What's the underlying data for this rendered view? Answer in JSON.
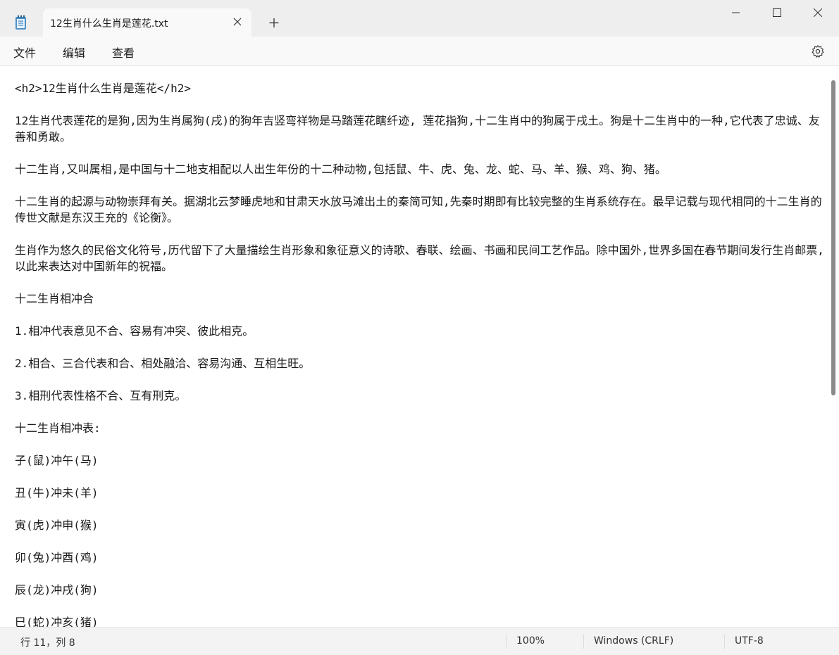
{
  "tab": {
    "title": "12生肖什么生肖是莲花.txt"
  },
  "menu": {
    "file": "文件",
    "edit": "编辑",
    "view": "查看"
  },
  "editor": {
    "lines": [
      "<h2>12生肖什么生肖是莲花</h2>",
      "12生肖代表莲花的是狗,因为生肖属狗(戌)的狗年吉竖弯祥物是马踏莲花瞎纤迹, 莲花指狗,十二生肖中的狗属于戌土。狗是十二生肖中的一种,它代表了忠诚、友善和勇敢。",
      "十二生肖,又叫属相,是中国与十二地支相配以人出生年份的十二种动物,包括鼠、牛、虎、兔、龙、蛇、马、羊、猴、鸡、狗、猪。",
      "十二生肖的起源与动物崇拜有关。据湖北云梦睡虎地和甘肃天水放马滩出土的秦简可知,先秦时期即有比较完整的生肖系统存在。最早记载与现代相同的十二生肖的传世文献是东汉王充的《论衡》。",
      "生肖作为悠久的民俗文化符号,历代留下了大量描绘生肖形象和象征意义的诗歌、春联、绘画、书画和民间工艺作品。除中国外,世界多国在春节期间发行生肖邮票,以此来表达对中国新年的祝福。",
      "十二生肖相冲合",
      "1.相冲代表意见不合、容易有冲突、彼此相克。",
      "2.相合、三合代表和合、相处融洽、容易沟通、互相生旺。",
      "3.相刑代表性格不合、互有刑克。",
      "十二生肖相冲表:",
      "子(鼠)冲午(马)",
      "丑(牛)冲未(羊)",
      "寅(虎)冲申(猴)",
      "卯(兔)冲酉(鸡)",
      "辰(龙)冲戌(狗)",
      "巳(蛇)冲亥(猪)"
    ]
  },
  "status": {
    "position": "行 11，列 8",
    "zoom": "100%",
    "line_ending": "Windows (CRLF)",
    "encoding": "UTF-8"
  },
  "icons": {
    "app": "notepad-icon",
    "close_tab": "close-icon",
    "new_tab": "plus-icon",
    "minimize": "minimize-icon",
    "maximize": "maximize-icon",
    "close_window": "close-icon",
    "settings": "gear-icon"
  }
}
